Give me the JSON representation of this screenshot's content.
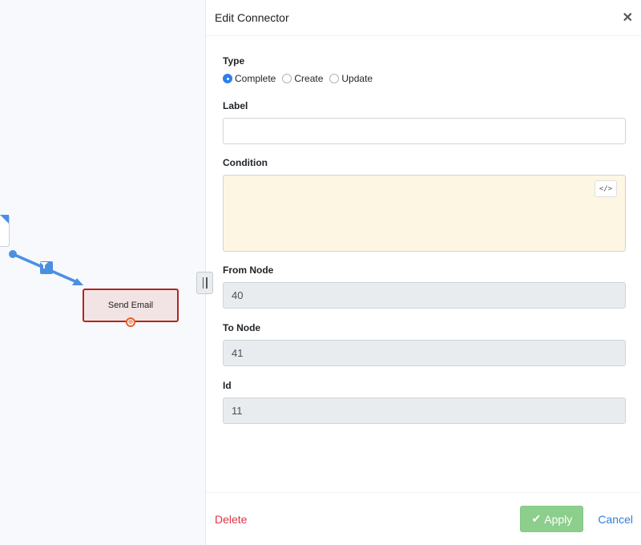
{
  "canvas": {
    "task_node_label": "Send Email",
    "filter_icon": "funnel-icon",
    "connector_color": "#4a90e2"
  },
  "panel": {
    "title": "Edit Connector",
    "close_icon": "close-icon",
    "type_label": "Type",
    "type_options": [
      {
        "label": "Complete",
        "checked": true
      },
      {
        "label": "Create",
        "checked": false
      },
      {
        "label": "Update",
        "checked": false
      }
    ],
    "label_label": "Label",
    "label_value": "",
    "condition_label": "Condition",
    "condition_value": "",
    "code_button_icon": "code-icon",
    "code_button_text": "</>",
    "from_node_label": "From Node",
    "from_node_value": "40",
    "to_node_label": "To Node",
    "to_node_value": "41",
    "id_label": "Id",
    "id_value": "11"
  },
  "footer": {
    "delete_label": "Delete",
    "apply_label": "Apply",
    "apply_icon": "check-icon",
    "cancel_label": "Cancel"
  }
}
